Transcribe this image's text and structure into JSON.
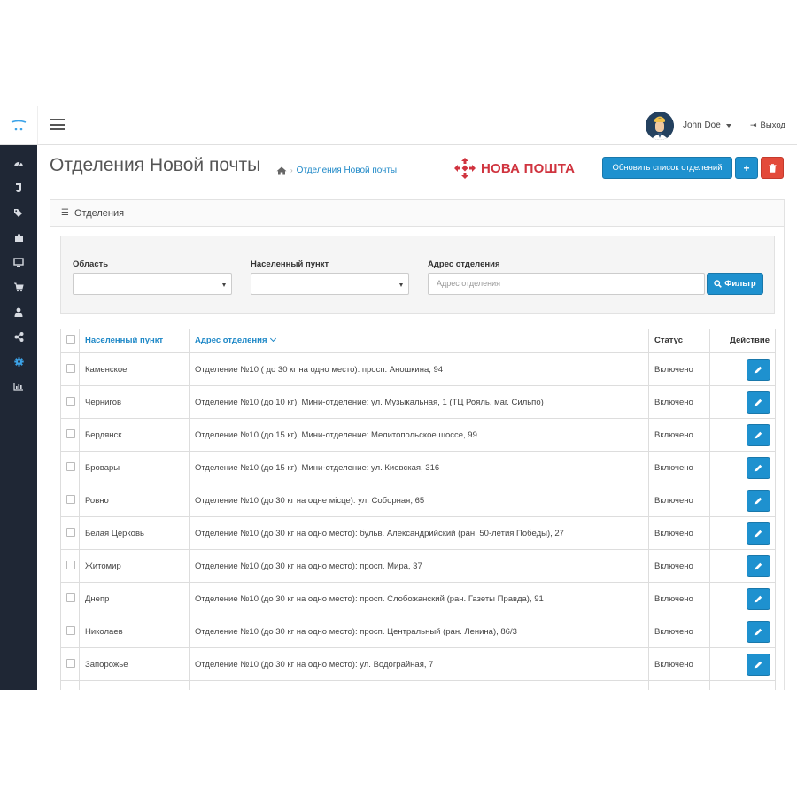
{
  "header": {
    "user_name": "John Doe",
    "logout_label": "Выход",
    "logout_icon": "sign-out-icon"
  },
  "sidebar": {
    "items": [
      {
        "icon": "dashboard-icon",
        "glyph": "◔"
      },
      {
        "icon": "catalog-icon",
        "glyph": "▐"
      },
      {
        "icon": "tags-icon",
        "glyph": "◆"
      },
      {
        "icon": "extensions-icon",
        "glyph": "✚"
      },
      {
        "icon": "design-icon",
        "glyph": "▭"
      },
      {
        "icon": "cart-icon",
        "glyph": "▬"
      },
      {
        "icon": "customers-icon",
        "glyph": "●"
      },
      {
        "icon": "share-icon",
        "glyph": "<"
      },
      {
        "icon": "settings-icon",
        "glyph": "✹",
        "active": true
      },
      {
        "icon": "reports-icon",
        "glyph": "▥"
      }
    ]
  },
  "page": {
    "title": "Отделения Новой почты",
    "breadcrumb": "Отделения Новой почты",
    "logo_text": "НОВА ПОШТА",
    "update_button": "Обновить список отделений",
    "add_button": "+",
    "delete_icon": "trash-icon"
  },
  "panel": {
    "heading": "Отделения",
    "filter": {
      "region_label": "Область",
      "city_label": "Населенный пункт",
      "address_label": "Адрес отделения",
      "address_placeholder": "Адрес отделения",
      "filter_button": "Фильтр"
    },
    "table": {
      "headers": {
        "city": "Населенный пункт",
        "address": "Адрес отделения",
        "status": "Статус",
        "action": "Действие"
      },
      "rows": [
        {
          "city": "Каменское",
          "address": "Отделение №10 ( до 30 кг на одно место): просп. Аношкина, 94",
          "status": "Включено"
        },
        {
          "city": "Чернигов",
          "address": "Отделение №10 (до 10 кг), Мини-отделение: ул. Музыкальная, 1 (ТЦ Рояль, маг. Сильпо)",
          "status": "Включено"
        },
        {
          "city": "Бердянск",
          "address": "Отделение №10 (до 15 кг), Мини-отделение: Мелитопольское шоссе, 99",
          "status": "Включено"
        },
        {
          "city": "Бровары",
          "address": "Отделение №10 (до 15 кг), Мини-отделение: ул. Киевская, 316",
          "status": "Включено"
        },
        {
          "city": "Ровно",
          "address": "Отделение №10 (до 30 кг на одне місце): ул. Соборная, 65",
          "status": "Включено"
        },
        {
          "city": "Белая Церковь",
          "address": "Отделение №10 (до 30 кг на одно место): бульв. Александрийский (ран. 50-летия Победы), 27",
          "status": "Включено"
        },
        {
          "city": "Житомир",
          "address": "Отделение №10 (до 30 кг на одно место): просп. Мира, 37",
          "status": "Включено"
        },
        {
          "city": "Днепр",
          "address": "Отделение №10 (до 30 кг на одно место): просп. Слобожанский (ран. Газеты Правда), 91",
          "status": "Включено"
        },
        {
          "city": "Николаев",
          "address": "Отделение №10 (до 30 кг на одно место): просп. Центральный (ран. Ленина), 86/3",
          "status": "Включено"
        },
        {
          "city": "Запорожье",
          "address": "Отделение №10 (до 30 кг на одно место): ул. Водограйная, 7",
          "status": "Включено"
        },
        {
          "city": "",
          "address": "",
          "status": ""
        }
      ]
    }
  },
  "colors": {
    "primary": "#1e91cf",
    "danger": "#e34a3a",
    "sidebar": "#1f2735",
    "brand_red": "#d0343f",
    "link": "#1e88c7"
  }
}
